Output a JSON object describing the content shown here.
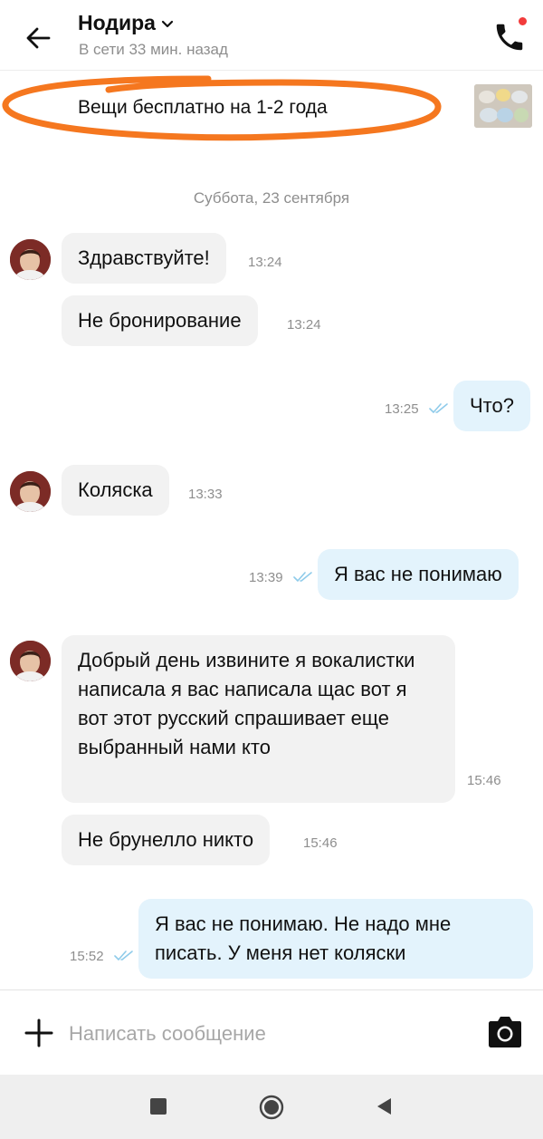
{
  "header": {
    "contact_name": "Нодира",
    "status": "В сети 33 мин. назад",
    "icons": {
      "back": "arrow-left-icon",
      "chevron": "chevron-down-icon",
      "call": "phone-icon"
    },
    "notification_dot_color": "#f23b3b"
  },
  "listing": {
    "title": "Вещи бесплатно на 1-2 года",
    "highlight_color": "#f5771f"
  },
  "chat": {
    "date": "Суббота, 23 сентября",
    "messages": [
      {
        "dir": "in",
        "text": "Здравствуйте!",
        "time": "13:24"
      },
      {
        "dir": "in",
        "text": "Не бронирование",
        "time": "13:24"
      },
      {
        "dir": "out",
        "text": "Что?",
        "time": "13:25",
        "read": true
      },
      {
        "dir": "in",
        "text": "Коляска",
        "time": "13:33"
      },
      {
        "dir": "out",
        "text": "Я вас не понимаю",
        "time": "13:39",
        "read": true
      },
      {
        "dir": "in",
        "text": "Добрый день извините я вокалистки написала я вас написала щас вот я вот этот русский спрашивает еще выбранный нами кто",
        "time": "15:46"
      },
      {
        "dir": "in",
        "text": "Не брунелло никто",
        "time": "15:46"
      },
      {
        "dir": "out",
        "text": "Я вас не понимаю. Не надо мне писать. У меня нет коляски",
        "time": "15:52",
        "read": true
      }
    ]
  },
  "composer": {
    "placeholder": "Написать сообщение",
    "icons": {
      "attach": "plus-icon",
      "camera": "camera-icon"
    }
  },
  "system_nav": {
    "icons": [
      "recents-square-icon",
      "home-circle-icon",
      "back-triangle-icon"
    ]
  },
  "colors": {
    "incoming_bubble": "#f2f2f2",
    "outgoing_bubble": "#e3f3fc",
    "read_ticks": "#8fcbea",
    "muted_text": "#8e8e8e"
  }
}
